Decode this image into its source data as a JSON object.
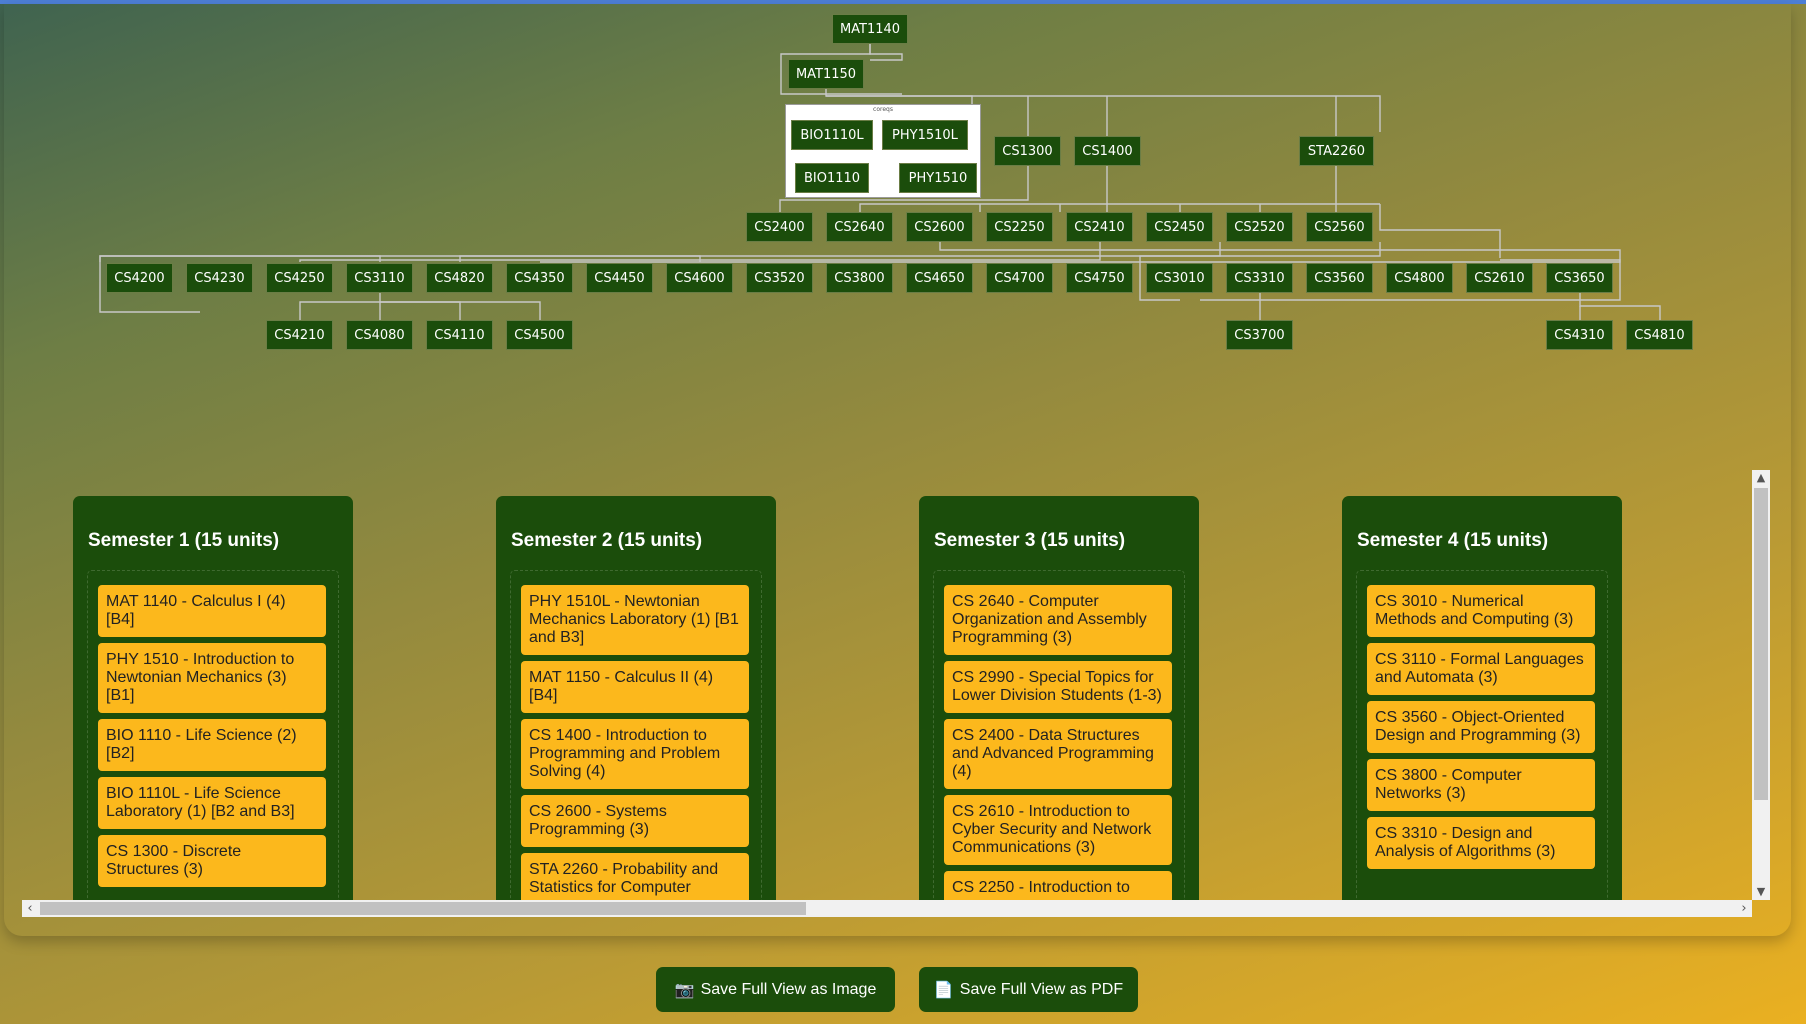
{
  "graph": {
    "coreq_label": "coreqs",
    "nodes": [
      "MAT1140",
      "MAT1150",
      "BIO1110L",
      "PHY1510L",
      "BIO1110",
      "PHY1510",
      "CS1300",
      "CS1400",
      "STA2260",
      "CS2400",
      "CS2640",
      "CS2600",
      "CS2250",
      "CS2410",
      "CS2450",
      "CS2520",
      "CS2560",
      "CS4200",
      "CS4230",
      "CS4250",
      "CS3110",
      "CS4820",
      "CS4350",
      "CS4450",
      "CS4600",
      "CS3520",
      "CS3800",
      "CS4650",
      "CS4700",
      "CS4750",
      "CS3010",
      "CS3310",
      "CS3560",
      "CS4800",
      "CS2610",
      "CS3650",
      "CS4210",
      "CS4080",
      "CS4110",
      "CS4500",
      "CS3700",
      "CS4310",
      "CS4810"
    ]
  },
  "semesters": [
    {
      "title": "Semester 1 (15 units)",
      "courses": [
        "MAT 1140 - Calculus I (4) [B4]",
        "PHY 1510 - Introduction to Newtonian Mechanics (3) [B1]",
        "BIO 1110 - Life Science (2) [B2]",
        "BIO 1110L - Life Science Laboratory (1) [B2 and B3]",
        "CS 1300 - Discrete Structures (3)"
      ]
    },
    {
      "title": "Semester 2 (15 units)",
      "courses": [
        "PHY 1510L - Newtonian Mechanics Laboratory (1) [B1 and B3]",
        "MAT 1150 - Calculus II (4) [B4]",
        "CS 1400 - Introduction to Programming and Problem Solving (4)",
        "CS 2600 - Systems Programming (3)",
        "STA 2260 - Probability and Statistics for Computer"
      ]
    },
    {
      "title": "Semester 3 (15 units)",
      "courses": [
        "CS 2640 - Computer Organization and Assembly Programming (3)",
        "CS 2990 - Special Topics for Lower Division Students (1-3)",
        "CS 2400 - Data Structures and Advanced Programming (4)",
        "CS 2610 - Introduction to Cyber Security and Network Communications (3)",
        "CS 2250 - Introduction to"
      ]
    },
    {
      "title": "Semester 4 (15 units)",
      "courses": [
        "CS 3010 - Numerical Methods and Computing (3)",
        "CS 3110 - Formal Languages and Automata (3)",
        "CS 3560 - Object-Oriented Design and Programming (3)",
        "CS 3800 - Computer Networks (3)",
        "CS 3310 - Design and Analysis of Algorithms (3)"
      ]
    }
  ],
  "buttons": {
    "save_image": "Save Full View as Image",
    "save_pdf": "Save Full View as PDF"
  },
  "icons": {
    "save_image": "camera-icon",
    "save_pdf": "page-icon"
  },
  "colors": {
    "node": "#1b4d0b",
    "course": "#fcb81c",
    "semester": "#1b4d0b"
  }
}
